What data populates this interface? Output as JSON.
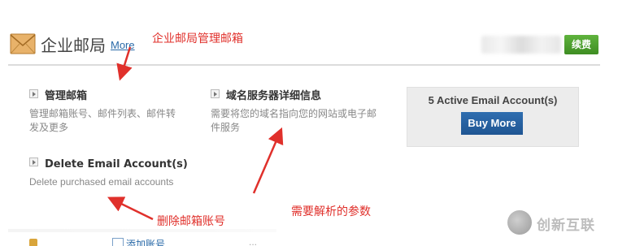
{
  "header": {
    "title": "企业邮局",
    "more_link": "More",
    "renew_button": "续费"
  },
  "features": [
    {
      "title": "管理邮箱",
      "description": "管理邮箱账号、邮件列表、邮件转发及更多"
    },
    {
      "title": "域名服务器详细信息",
      "description": "需要将您的域名指向您的网站或电子邮件服务"
    },
    {
      "title": "Delete Email Account(s)",
      "description": "Delete purchased email accounts"
    }
  ],
  "account_panel": {
    "count_label": "5 Active Email Account(s)",
    "buy_button": "Buy More"
  },
  "annotations": {
    "manage_note": "企业邮局管理邮箱",
    "params_note": "需要解析的参数",
    "delete_note": "删除邮箱账号"
  },
  "bottom": {
    "link_text": "添加账号",
    "dots": "..."
  },
  "watermark": {
    "text": "创新互联"
  },
  "colors": {
    "annotation": "#e0302b",
    "renew_button": "#4aa02c",
    "buy_button": "#2563a8",
    "link": "#2a6aa8"
  }
}
